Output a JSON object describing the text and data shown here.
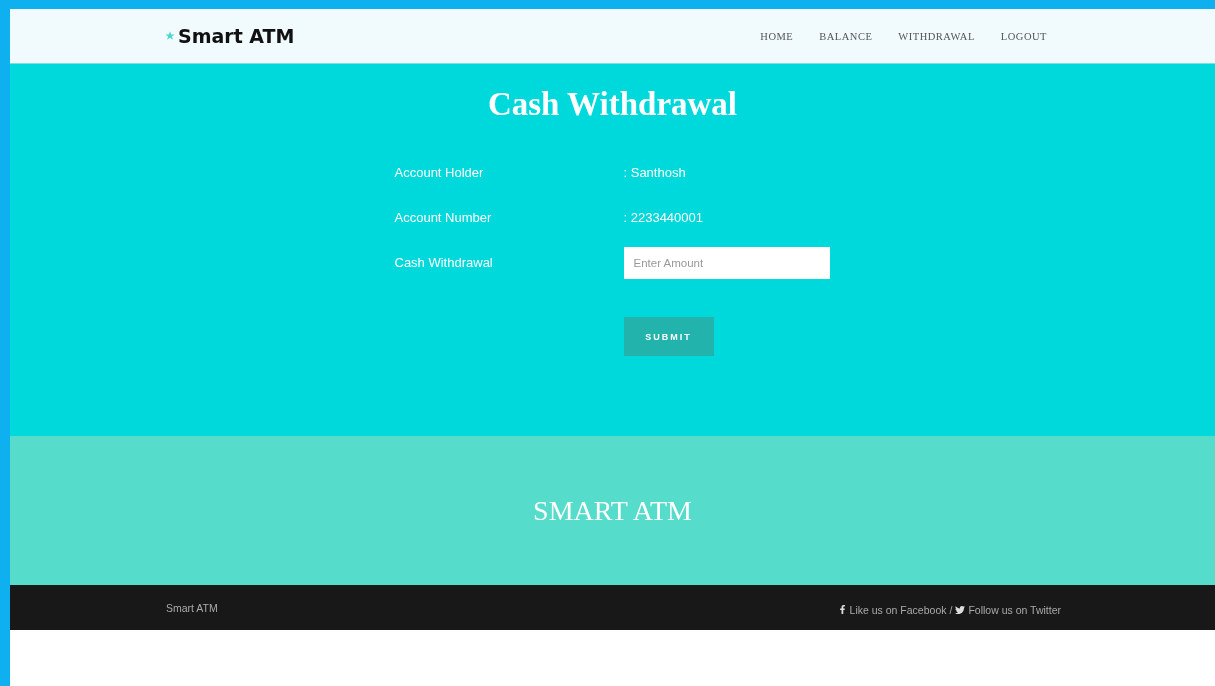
{
  "brand": {
    "name": "Smart ATM"
  },
  "nav": [
    {
      "label": "HOME"
    },
    {
      "label": "BALANCE"
    },
    {
      "label": "WITHDRAWAL"
    },
    {
      "label": "LOGOUT"
    }
  ],
  "heading": "Cash Withdrawal",
  "details": [
    {
      "kind": "text",
      "label": "Account Holder",
      "value": ": Santhosh"
    },
    {
      "kind": "text",
      "label": "Account Number",
      "value": ": 2233440001"
    },
    {
      "kind": "input",
      "label": "Cash Withdrawal",
      "placeholder": "Enter Amount"
    }
  ],
  "submit": "SUBMIT",
  "banner": "SMART ATM",
  "footer": {
    "copyright": "Smart ATM",
    "facebook": "Like us on Facebook",
    "separator": "/",
    "twitter": "Follow us on Twitter"
  }
}
